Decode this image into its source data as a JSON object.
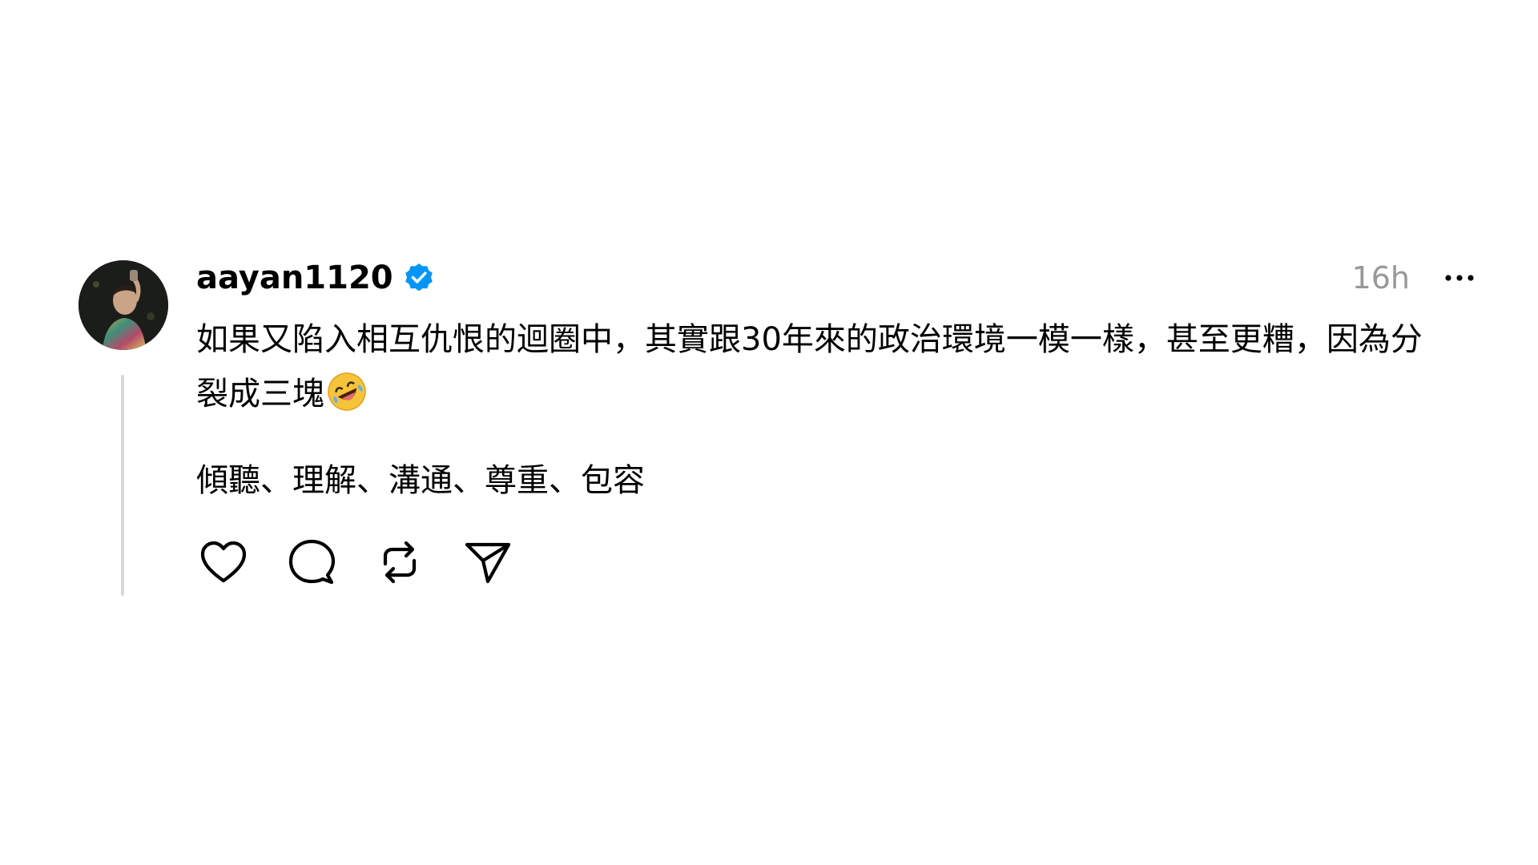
{
  "post": {
    "username": "aayan1120",
    "verified": true,
    "timestamp": "16h",
    "paragraphs": [
      "如果又陷入相互仇恨的迴圈中，其實跟30年來的政治環境一模一樣，甚至更糟，因為分裂成三塊",
      "傾聽、理解、溝通、尊重、包容"
    ],
    "emoji": "rolling-on-floor-laughing"
  },
  "icons": {
    "verified": "verified-badge-icon",
    "more": "more-options-icon",
    "like": "heart-icon",
    "reply": "comment-icon",
    "repost": "repost-icon",
    "share": "send-icon"
  },
  "colors": {
    "background": "#ffffff",
    "text": "#000000",
    "muted": "#999999",
    "verified": "#0095f6",
    "thread_line": "#d9d9d9"
  }
}
